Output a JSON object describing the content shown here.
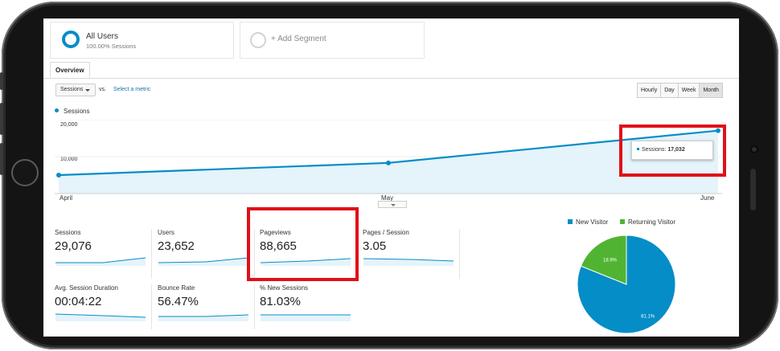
{
  "segments": [
    {
      "title": "All Users",
      "subtitle": "100.00% Sessions"
    },
    {
      "title": "+ Add Segment"
    }
  ],
  "tabs": [
    {
      "label": "Overview"
    }
  ],
  "controls": {
    "metric": "Sessions",
    "vs": "vs.",
    "select_metric": "Select a metric",
    "granularity": [
      "Hourly",
      "Day",
      "Week",
      "Month"
    ],
    "active_granularity": "Month"
  },
  "chart_data": {
    "type": "area",
    "legend": "Sessions",
    "categories": [
      "April",
      "May",
      "June"
    ],
    "series": [
      {
        "name": "Sessions",
        "values": [
          5000,
          8300,
          17032
        ]
      }
    ],
    "yticks": [
      "20,000",
      "10,000"
    ],
    "ylim": [
      0,
      20000
    ],
    "tooltip": {
      "label": "Sessions:",
      "value": "17,032"
    },
    "color": "#058dc7"
  },
  "metrics": [
    {
      "label": "Sessions",
      "value": "29,076"
    },
    {
      "label": "Users",
      "value": "23,652"
    },
    {
      "label": "Pageviews",
      "value": "88,665"
    },
    {
      "label": "Pages / Session",
      "value": "3.05"
    },
    {
      "label": "Avg. Session Duration",
      "value": "00:04:22"
    },
    {
      "label": "Bounce Rate",
      "value": "56.47%"
    },
    {
      "label": "% New Sessions",
      "value": "81.03%"
    }
  ],
  "pie": {
    "type": "pie",
    "legend": [
      {
        "label": "New Visitor",
        "color": "#058dc7"
      },
      {
        "label": "Returning Visitor",
        "color": "#50b432"
      }
    ],
    "slices": [
      {
        "label": "81.1%",
        "value": 81.1,
        "color": "#058dc7"
      },
      {
        "label": "18.9%",
        "value": 18.9,
        "color": "#50b432"
      }
    ]
  },
  "highlight_color": "#e0101a"
}
